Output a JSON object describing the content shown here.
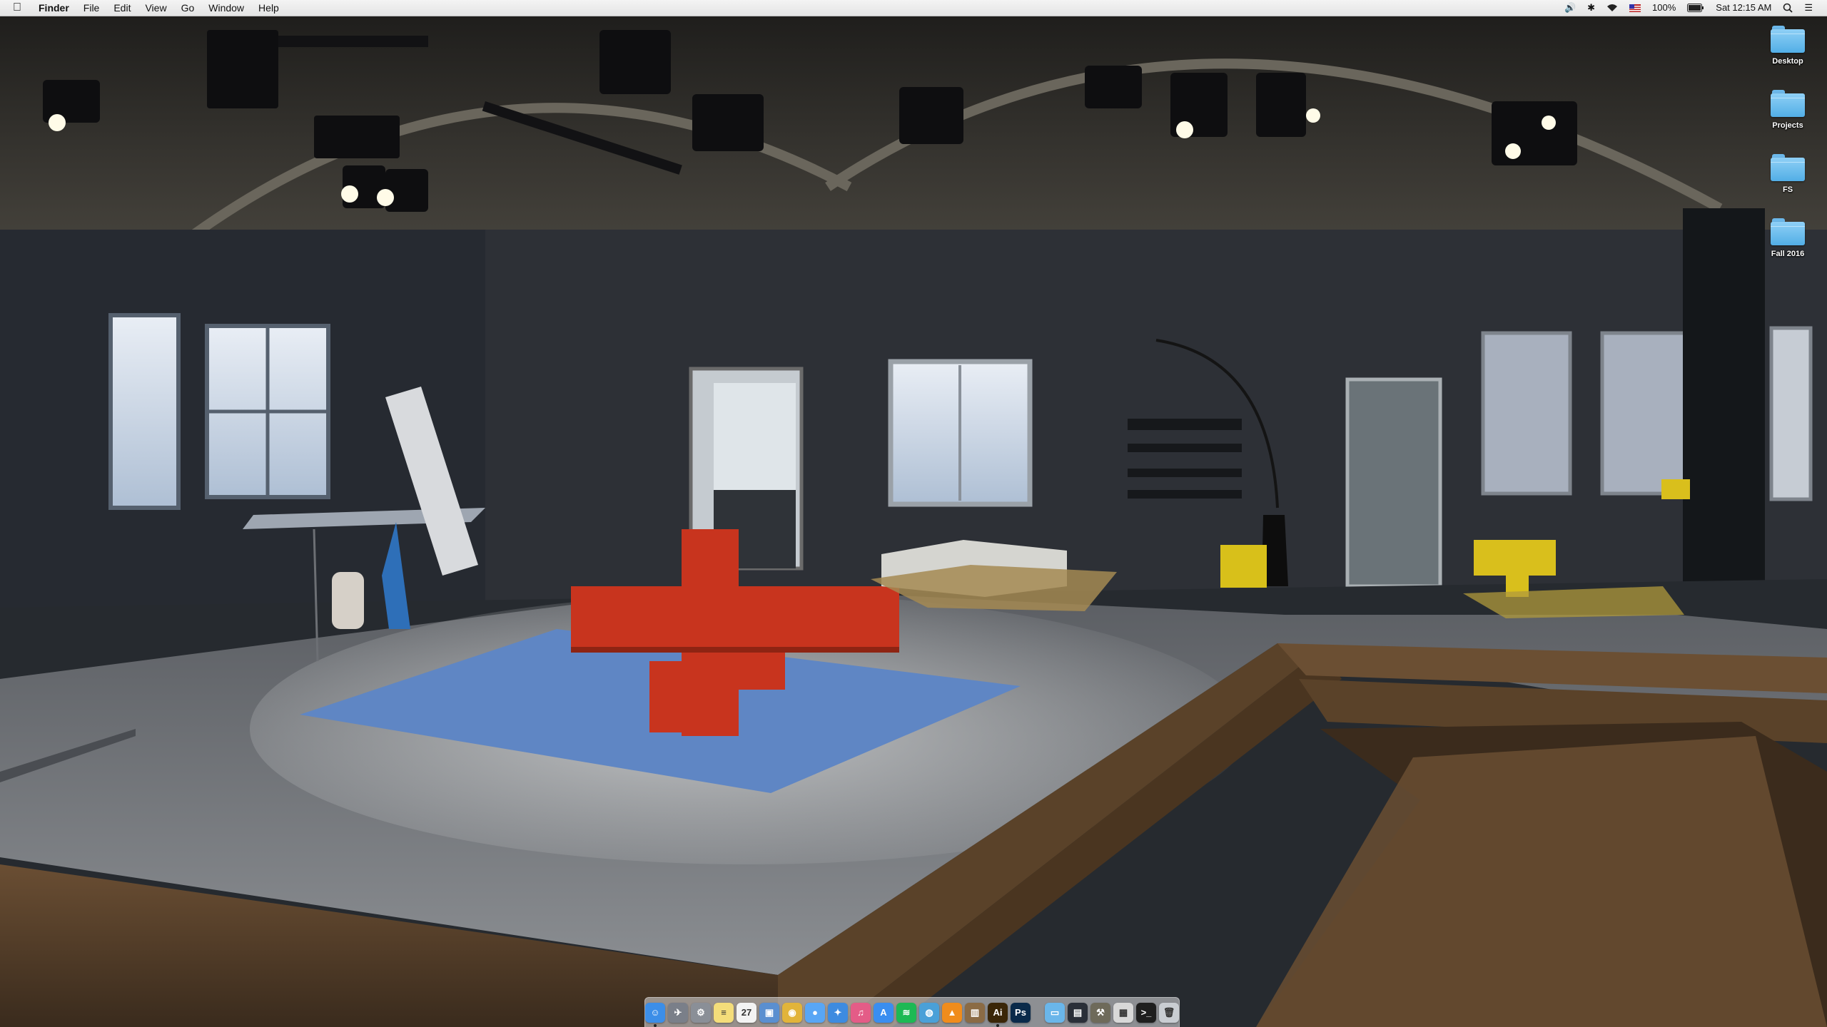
{
  "menubar": {
    "app": "Finder",
    "menus": [
      "File",
      "Edit",
      "View",
      "Go",
      "Window",
      "Help"
    ],
    "status": {
      "battery": "100%",
      "clock": "Sat 12:15 AM"
    }
  },
  "desktop": {
    "folders": [
      "Desktop",
      "Projects",
      "FS",
      "Fall 2016"
    ]
  },
  "dock": {
    "apps": [
      {
        "name": "Finder",
        "icon": "finder-icon",
        "glyph": "☺",
        "color": "#3c8ee8"
      },
      {
        "name": "Launchpad",
        "icon": "rocket-icon",
        "glyph": "✈",
        "color": "#7a7f89"
      },
      {
        "name": "System Preferences",
        "icon": "gear-icon",
        "glyph": "⚙",
        "color": "#8a8f97"
      },
      {
        "name": "Notes",
        "icon": "notes-icon",
        "glyph": "≡",
        "color": "#f4dd7a"
      },
      {
        "name": "Calendar",
        "icon": "calendar-icon",
        "glyph": "27",
        "color": "#f3f3f3"
      },
      {
        "name": "Preview",
        "icon": "preview-icon",
        "glyph": "▣",
        "color": "#5a8fd0"
      },
      {
        "name": "Chrome",
        "icon": "chrome-icon",
        "glyph": "◉",
        "color": "#e2b43a"
      },
      {
        "name": "Messages",
        "icon": "messages-icon",
        "glyph": "●",
        "color": "#58a6f5"
      },
      {
        "name": "Safari",
        "icon": "safari-icon",
        "glyph": "✦",
        "color": "#3d8be0"
      },
      {
        "name": "iTunes",
        "icon": "music-icon",
        "glyph": "♫",
        "color": "#e45c87"
      },
      {
        "name": "App Store",
        "icon": "appstore-icon",
        "glyph": "A",
        "color": "#3a8ef0"
      },
      {
        "name": "Spotify",
        "icon": "spotify-icon",
        "glyph": "≋",
        "color": "#1db954"
      },
      {
        "name": "Globe",
        "icon": "globe-icon",
        "glyph": "◍",
        "color": "#4aa0d8"
      },
      {
        "name": "VLC",
        "icon": "vlc-icon",
        "glyph": "▲",
        "color": "#f08c1c"
      },
      {
        "name": "Books",
        "icon": "books-icon",
        "glyph": "▥",
        "color": "#8b6b45"
      },
      {
        "name": "Illustrator",
        "icon": "illustrator-icon",
        "glyph": "Ai",
        "color": "#3a2608"
      },
      {
        "name": "Photoshop",
        "icon": "photoshop-icon",
        "glyph": "Ps",
        "color": "#0a2a4a"
      }
    ],
    "utilities": [
      {
        "name": "Applications",
        "icon": "folder-icon",
        "glyph": "▭",
        "color": "#6ab6ea"
      },
      {
        "name": "Screenshot",
        "icon": "screenshot-icon",
        "glyph": "▤",
        "color": "#2a2f38"
      },
      {
        "name": "Utilities",
        "icon": "tools-icon",
        "glyph": "⚒",
        "color": "#6e6a5a"
      },
      {
        "name": "Documents",
        "icon": "documents-icon",
        "glyph": "▦",
        "color": "#d8d8d8"
      },
      {
        "name": "Terminal",
        "icon": "terminal-icon",
        "glyph": ">_",
        "color": "#1e1e1e"
      },
      {
        "name": "Trash",
        "icon": "trash-icon",
        "glyph": "🗑",
        "color": "#c9cdd2"
      }
    ]
  }
}
